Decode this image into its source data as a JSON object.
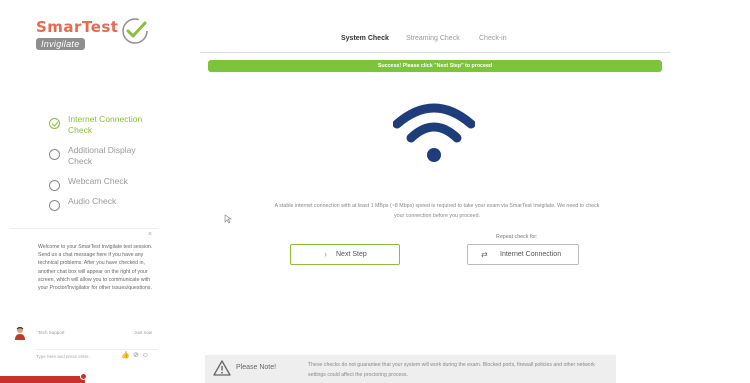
{
  "brand": {
    "name": "SmarTest",
    "sub": "Invigilate",
    "accent": "#e46b50",
    "success": "#8bbf3a"
  },
  "sidebar": {
    "steps": [
      {
        "label": "Internet Connection Check",
        "status": "done"
      },
      {
        "label": "Additional Display Check",
        "status": "pending"
      },
      {
        "label": "Webcam Check",
        "status": "pending"
      },
      {
        "label": "Audio Check",
        "status": "pending"
      }
    ]
  },
  "chat": {
    "close": "×",
    "message": "Welcome to your SmarTest Invigilate test session. Send us a chat message here if you have any technical problems. After you have checked in, another chat box will appear on the right of your screen, which will allow you to communicate with your Proctor/Invigilator for other issues/questions.",
    "sender": "Tech Support",
    "time": "Just now",
    "input_placeholder": "Type here and press enter..",
    "icons": [
      "thumbs-up-icon",
      "attachment-icon",
      "emoji-icon"
    ]
  },
  "tabs": [
    {
      "label": "System Check",
      "active": true
    },
    {
      "label": "Streaming Check",
      "active": false
    },
    {
      "label": "Check-in",
      "active": false
    }
  ],
  "banner": {
    "text": "Success! Please click \"Next Step\" to proceed"
  },
  "main": {
    "description": "A stable internet connection with at least 1 MBps (~8 Mbps) speed is required to take your exam via SmarTest Invigilate. We need to check your connection before you proceed.",
    "next_button": "Next Step",
    "repeat_label": "Repeat check for:",
    "repeat_button": "Internet Connection"
  },
  "note": {
    "title": "Please Note!",
    "text": "These checks do not guarantee that your system will work during the exam. Blocked ports, firewall policies and other network settings could affect the proctoring process."
  }
}
